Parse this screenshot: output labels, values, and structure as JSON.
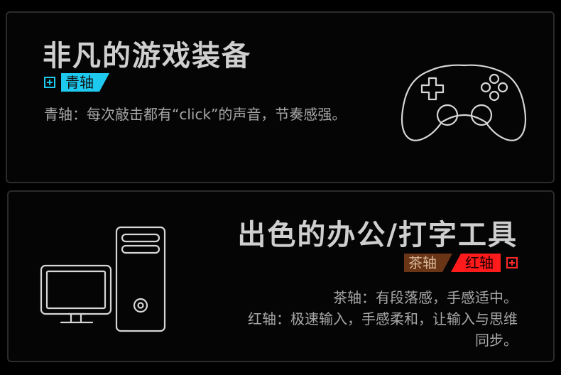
{
  "cards": [
    {
      "title": "非凡的游戏装备",
      "tags": [
        {
          "label": "青轴",
          "color": "#1ec9f0"
        }
      ],
      "description": "青轴：每次敲击都有“click”的声音，节奏感强。",
      "icon": "gamepad-icon"
    },
    {
      "title": "出色的办公/打字工具",
      "tags": [
        {
          "label": "茶轴",
          "color": "#6a3416"
        },
        {
          "label": "红轴",
          "color": "#ff1b1b"
        }
      ],
      "description_lines": [
        "茶轴：有段落感，手感适中。",
        "红轴：极速输入，手感柔和，让输入与思维",
        "同步。"
      ],
      "icon": "computer-icon"
    }
  ],
  "colors": {
    "background": "#000000",
    "card_border": "#2b2b2b",
    "text_primary": "#cfcfcf",
    "text_secondary": "#a7a7a7"
  }
}
